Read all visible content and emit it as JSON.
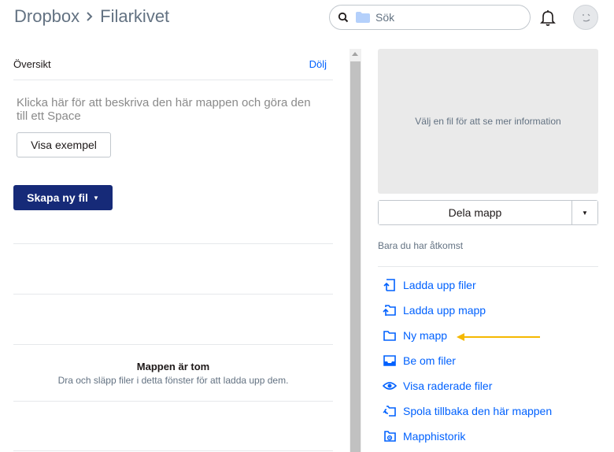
{
  "header": {
    "breadcrumb_root": "Dropbox",
    "breadcrumb_current": "Filarkivet",
    "search_placeholder": "Sök"
  },
  "overview": {
    "title": "Översikt",
    "hide_label": "Dölj",
    "description": "Klicka här för att beskriva den här mappen och göra den till ett Space",
    "example_button": "Visa exempel",
    "create_button": "Skapa ny fil"
  },
  "empty_state": {
    "title": "Mappen är tom",
    "subtitle": "Dra och släpp filer i detta fönster för att ladda upp dem."
  },
  "sidebar": {
    "preview_text": "Välj en fil för att se mer information",
    "share_button": "Dela mapp",
    "access_text": "Bara du har åtkomst",
    "actions": [
      {
        "label": "Ladda upp filer",
        "icon": "upload-file-icon"
      },
      {
        "label": "Ladda upp mapp",
        "icon": "upload-folder-icon"
      },
      {
        "label": "Ny mapp",
        "icon": "new-folder-icon"
      },
      {
        "label": "Be om filer",
        "icon": "request-files-icon"
      },
      {
        "label": "Visa raderade filer",
        "icon": "eye-icon"
      },
      {
        "label": "Spola tillbaka den här mappen",
        "icon": "rewind-icon"
      },
      {
        "label": "Mapphistorik",
        "icon": "folder-history-icon"
      }
    ]
  },
  "colors": {
    "accent_blue": "#0061fe",
    "create_button_bg": "#162a78",
    "annotation_arrow": "#f5b800"
  }
}
